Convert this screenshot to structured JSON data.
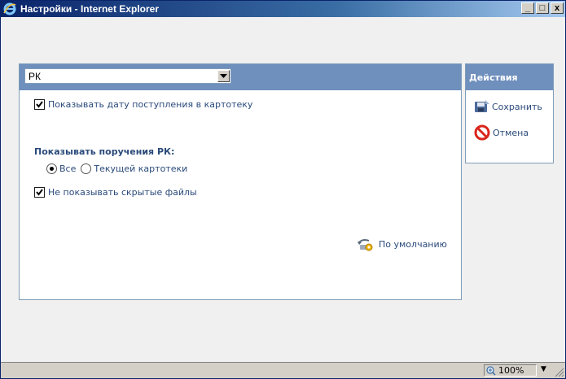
{
  "window": {
    "title": "Настройки - Internet Explorer",
    "buttons": {
      "minimize": "_",
      "maximize": "□",
      "close": "x"
    }
  },
  "main": {
    "select_value": "РК",
    "options": {
      "show_date_label": "Показывать дату поступления в картотеку",
      "show_date_checked": true,
      "section_label": "Показывать поручения РК:",
      "radio_all_label": "Все",
      "radio_all_checked": true,
      "radio_current_label": "Текущей картотеки",
      "radio_current_checked": false,
      "hide_files_label": "Не показывать скрытые файлы",
      "hide_files_checked": true
    },
    "default_label": "По умолчанию"
  },
  "actions": {
    "title": "Действия",
    "save_label": "Сохранить",
    "cancel_label": "Отмена"
  },
  "statusbar": {
    "zoom": "100%"
  },
  "colors": {
    "header": "#6f8fbd",
    "text": "#2a4a7a",
    "cancel_icon": "#d9261c"
  },
  "icons": [
    "ie-icon",
    "chevron-down-icon",
    "checkmark-icon",
    "default-settings-icon",
    "save-disk-icon",
    "cancel-no-entry-icon",
    "zoom-icon",
    "resize-grip-icon"
  ]
}
